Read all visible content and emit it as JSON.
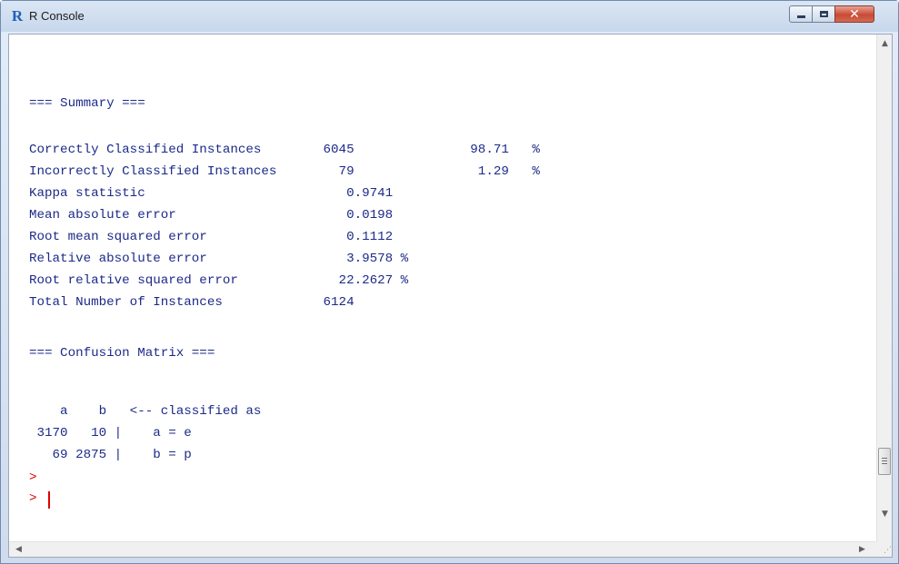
{
  "window": {
    "title": "R Console",
    "app_icon": "R",
    "icons": {
      "app": "r-logo-icon",
      "minimize": "minimize-icon",
      "maximize": "maximize-icon",
      "close": "close-icon"
    }
  },
  "console": {
    "lines": [
      "",
      "=== Summary ===",
      "",
      "Correctly Classified Instances        6045               98.71   %",
      "Incorrectly Classified Instances        79                1.29   %",
      "Kappa statistic                          0.9741",
      "Mean absolute error                      0.0198",
      "Root mean squared error                  0.1112",
      "Relative absolute error                  3.9578 %",
      "Root relative squared error             22.2627 %",
      "Total Number of Instances             6124",
      "",
      "=== Confusion Matrix ===",
      "",
      "    a    b   <-- classified as",
      " 3170   10 |    a = e",
      "   69 2875 |    b = p"
    ],
    "prompts": [
      ">",
      ">"
    ]
  },
  "scrollbars": {
    "up_arrow": "▲",
    "down_arrow": "▼",
    "left_arrow": "◀",
    "right_arrow": "▶"
  }
}
